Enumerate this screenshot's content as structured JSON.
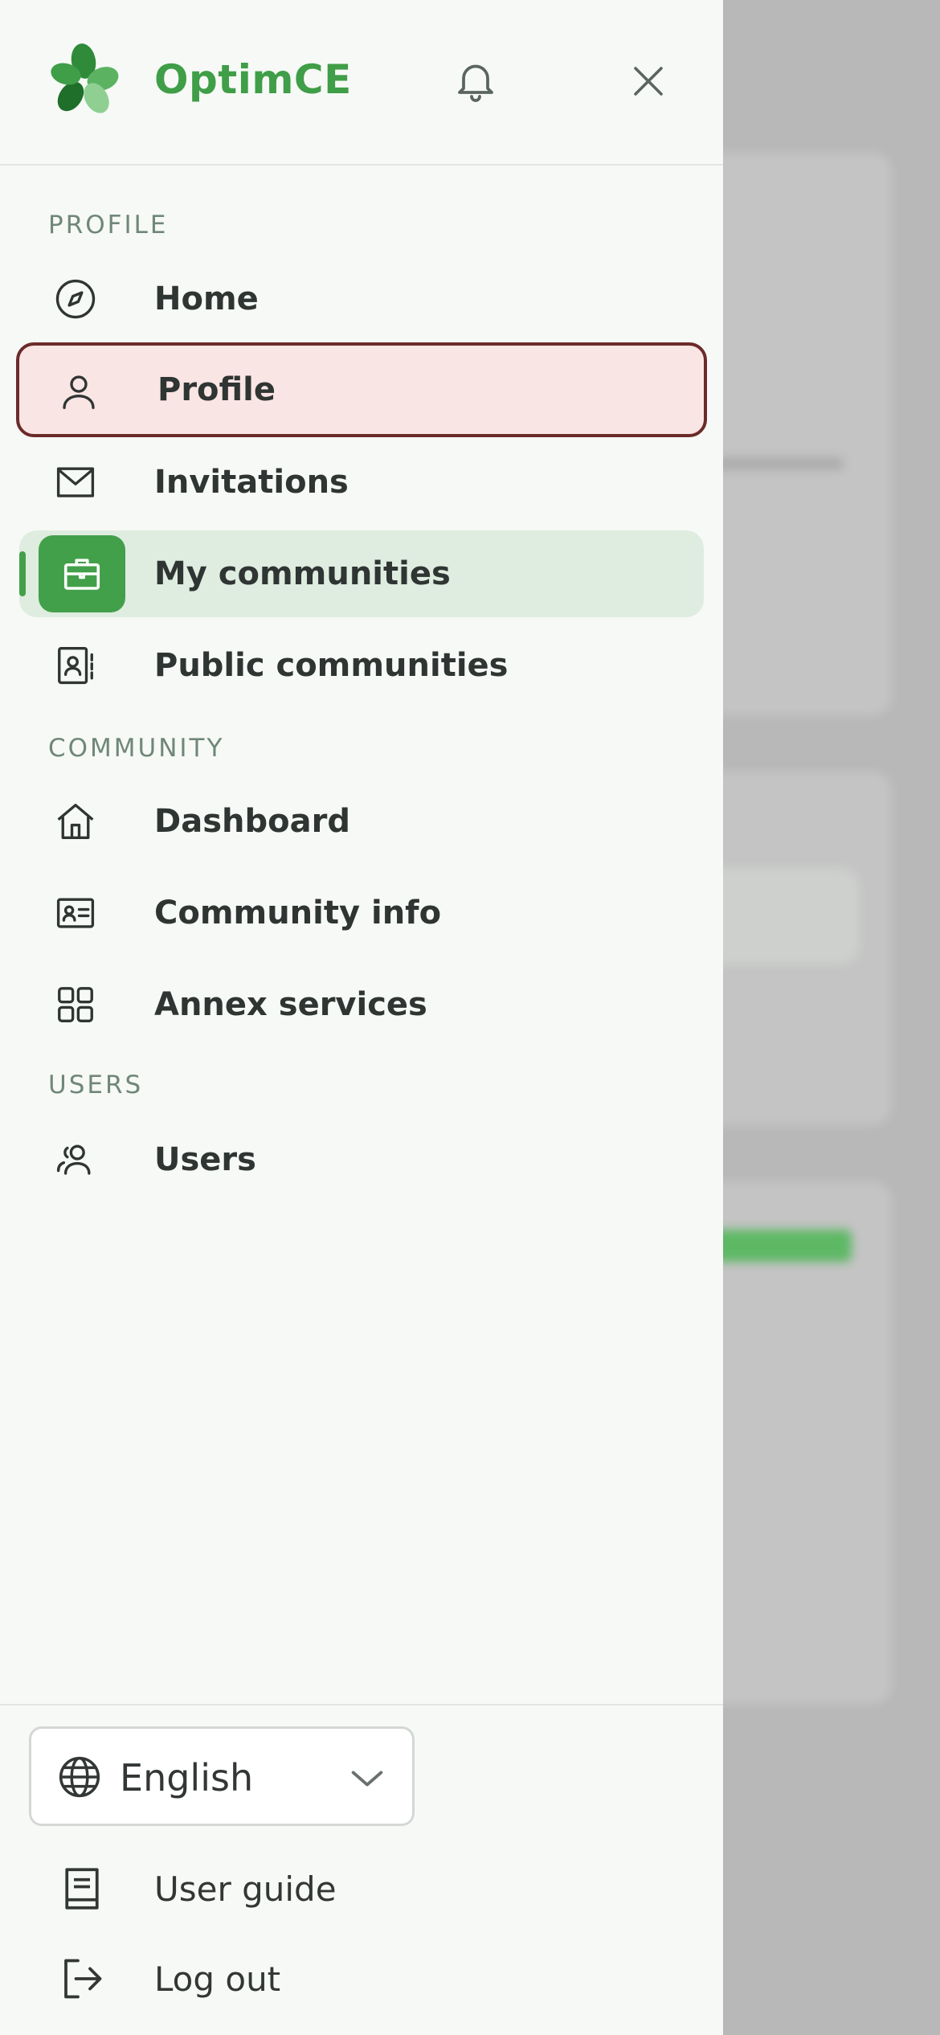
{
  "header": {
    "brand": "OptimCE",
    "icons": {
      "logo": "clover-logo",
      "bell": "bell-icon",
      "close": "close-icon"
    }
  },
  "colors": {
    "brand_green": "#3f9e47",
    "active_bg": "#dfece0",
    "focus_border": "#6b2b29",
    "focus_bg": "#f9e5e4"
  },
  "sections": {
    "profile": "PROFILE",
    "community": "COMMUNITY",
    "users": "USERS"
  },
  "nav": {
    "home": "Home",
    "profile": "Profile",
    "invitations": "Invitations",
    "my_communities": "My communities",
    "public_communities": "Public communities",
    "dashboard": "Dashboard",
    "community_info": "Community info",
    "annex_services": "Annex services",
    "users": "Users"
  },
  "states": {
    "active_item": "My communities",
    "focused_item": "Profile"
  },
  "footer": {
    "language": "English",
    "user_guide": "User guide",
    "log_out": "Log out"
  }
}
